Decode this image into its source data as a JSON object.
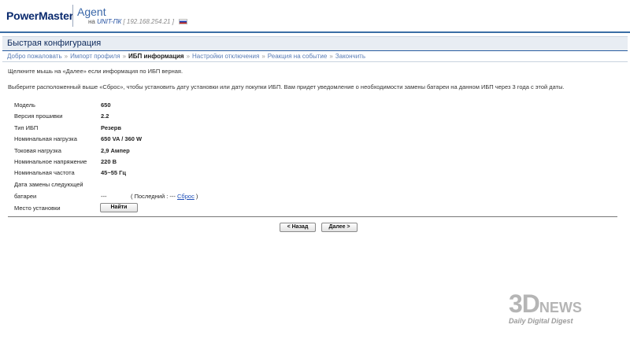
{
  "header": {
    "logo": "PowerMaster",
    "app_name": "Agent",
    "host_prefix": "на",
    "host_name": "UNIT-ПК",
    "host_ip": "[ 192.168.254.21 ]",
    "flag_icon": "russia-flag-icon"
  },
  "page": {
    "title": "Быстрая конфигурация"
  },
  "breadcrumbs": [
    {
      "label": "Добро пожаловать"
    },
    {
      "label": "Импорт профиля"
    },
    {
      "label": "ИБП информация"
    },
    {
      "label": "Настройки отключения"
    },
    {
      "label": "Реакция на событие"
    },
    {
      "label": "Закончить"
    }
  ],
  "breadcrumb_sep": "»",
  "content": {
    "intro": "Щелкните мышь на «Далее» если информация по ИБП верная.",
    "instructions": "Выберите расположенный выше «Сброс», чтобы установить дату установки или дату покупки ИБП. Вам придет уведомление о необходимости замены батареи на данном ИБП через 3 года с этой даты.",
    "rows": [
      {
        "label": "Модель",
        "value": "650"
      },
      {
        "label": "Версия прошивки",
        "value": "2.2"
      },
      {
        "label": "Тип ИБП",
        "value": "Резерв"
      },
      {
        "label": "Номинальная нагрузка",
        "value": "650 VA / 360 W"
      },
      {
        "label": "Токовая нагрузка",
        "value": "2,9 Ампер"
      },
      {
        "label": "Номинальное напряжение",
        "value": "220 В"
      },
      {
        "label": "Номинальная частота",
        "value": "45~55 Гц"
      }
    ],
    "battery_label_1": "Дата замены следующей",
    "battery_label_2": "батареи",
    "battery_value": "---",
    "last_prefix": "( Последний : --- ",
    "reset_link": "Сброс",
    "last_suffix": " )",
    "location_label": "Место установки",
    "find_button": "Найти"
  },
  "nav": {
    "back_button": "< Назад",
    "next_button": "Далее >"
  },
  "watermark": {
    "brand_main": "3D",
    "brand_news": "NEWS",
    "tagline": "Daily Digital Digest"
  },
  "colors": {
    "accent": "#3b6ea5",
    "logo": "#0a2a6e",
    "link": "#1f4fb8"
  }
}
